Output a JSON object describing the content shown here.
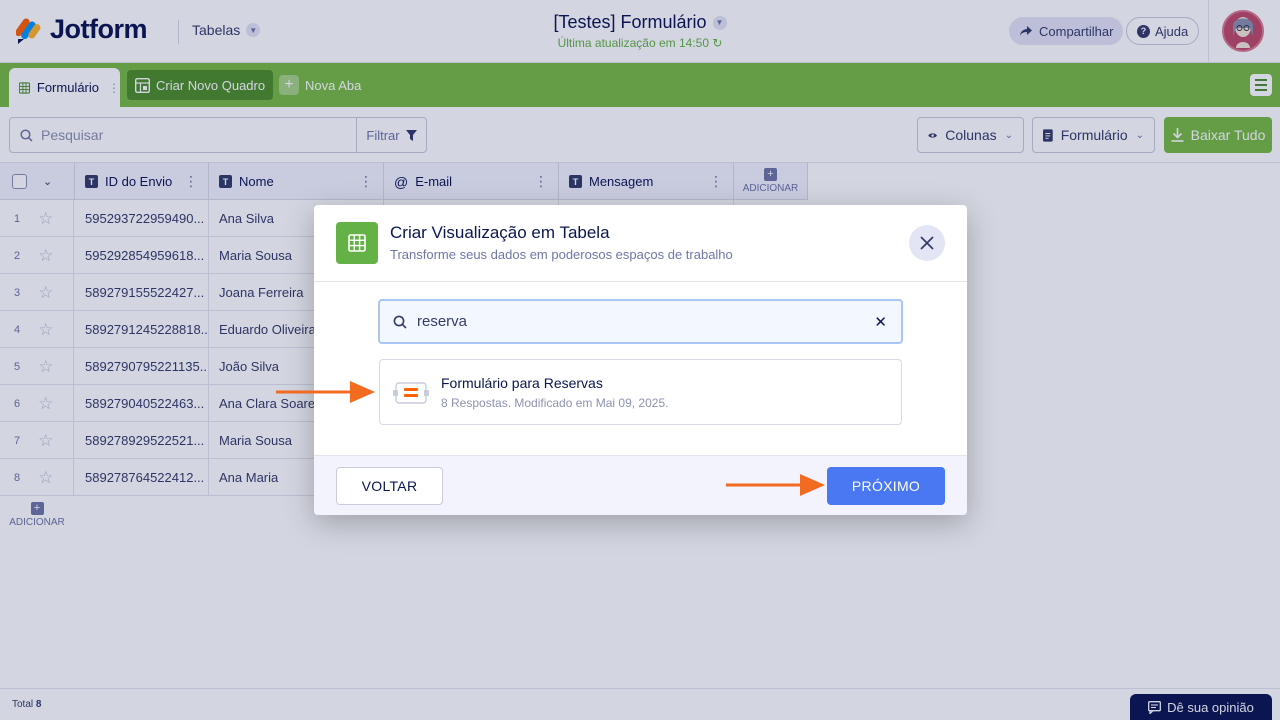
{
  "header": {
    "brand": "Jotform",
    "section": "Tabelas",
    "title": "[Testes] Formulário",
    "last_update": "Última atualização em 14:50",
    "share_label": "Compartilhar",
    "help_label": "Ajuda"
  },
  "tabs": {
    "active": "Formulário",
    "create_board": "Criar Novo Quadro",
    "new_tab": "Nova Aba"
  },
  "toolbar": {
    "search_placeholder": "Pesquisar",
    "filter_label": "Filtrar",
    "columns_label": "Colunas",
    "form_label": "Formulário",
    "download_label": "Baixar Tudo"
  },
  "table": {
    "columns": [
      "ID do Envio",
      "Nome",
      "E-mail",
      "Mensagem"
    ],
    "add_label": "ADICIONAR",
    "rows": [
      {
        "n": "1",
        "id": "595293722959490...",
        "name": "Ana Silva"
      },
      {
        "n": "2",
        "id": "595292854959618...",
        "name": "Maria Sousa"
      },
      {
        "n": "3",
        "id": "589279155522427...",
        "name": "Joana Ferreira"
      },
      {
        "n": "4",
        "id": "5892791245228818...",
        "name": "Eduardo Oliveira"
      },
      {
        "n": "5",
        "id": "5892790795221135...",
        "name": "João Silva"
      },
      {
        "n": "6",
        "id": "589279040522463...",
        "name": "Ana Clara Soares"
      },
      {
        "n": "7",
        "id": "589278929522521...",
        "name": "Maria Sousa"
      },
      {
        "n": "8",
        "id": "589278764522412...",
        "name": "Ana Maria"
      }
    ]
  },
  "footer": {
    "total_label": "Total",
    "total_value": "8",
    "feedback_label": "Dê sua opinião"
  },
  "modal": {
    "title": "Criar Visualização em Tabela",
    "subtitle": "Transforme seus dados em poderosos espaços de trabalho",
    "search_value": "reserva",
    "result_title": "Formulário para Reservas",
    "result_meta": "8 Respostas. Modificado em Mai 09, 2025.",
    "back_label": "VOLTAR",
    "next_label": "PRÓXIMO"
  },
  "colors": {
    "brand_green": "#78bb43",
    "primary_blue": "#4a77f2",
    "arrow_orange": "#f26b21",
    "navy": "#0a1551"
  }
}
